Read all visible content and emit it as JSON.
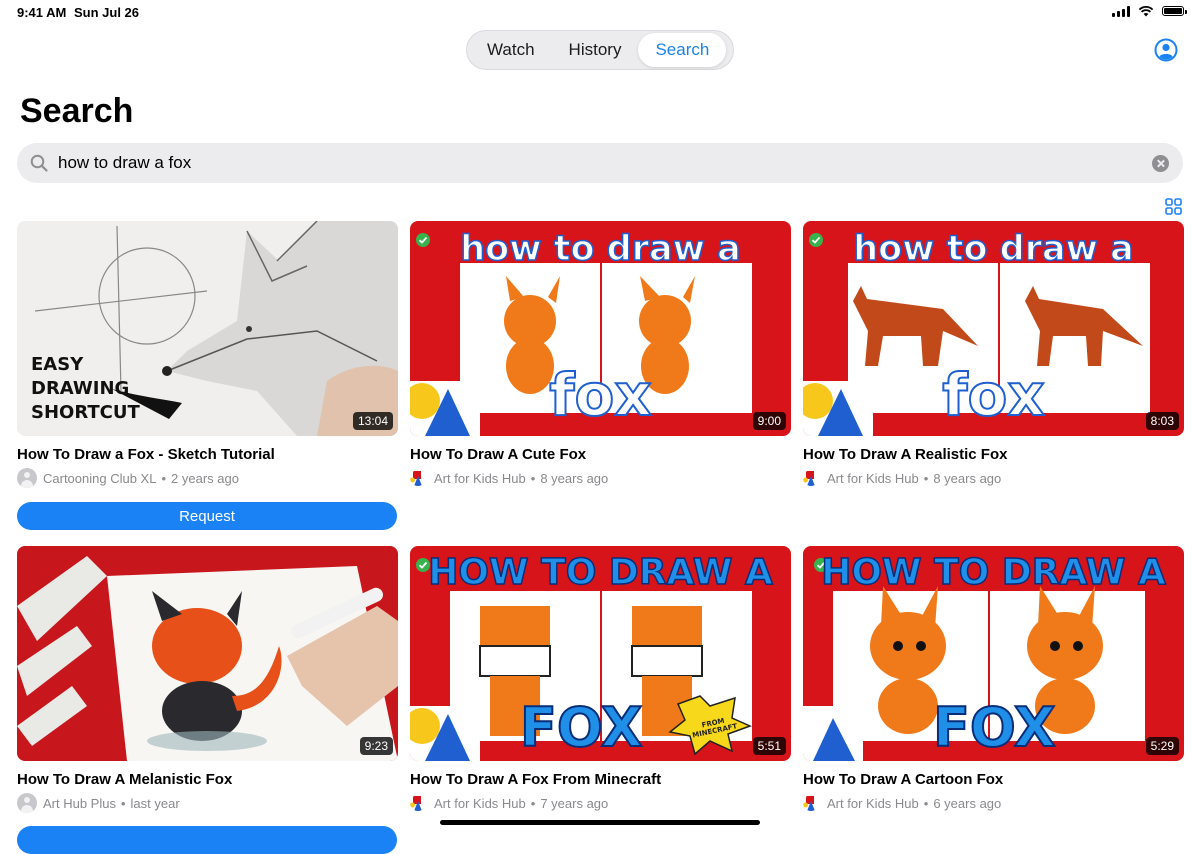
{
  "status_bar": {
    "time": "9:41 AM",
    "date": "Sun Jul 26"
  },
  "tabs": [
    {
      "label": "Watch",
      "active": false
    },
    {
      "label": "History",
      "active": false
    },
    {
      "label": "Search",
      "active": true
    }
  ],
  "page_title": "Search",
  "search": {
    "value": "how to draw a fox",
    "placeholder": "Search"
  },
  "videos": [
    {
      "title": "How To Draw a Fox - Sketch Tutorial",
      "channel": "Cartooning Club XL",
      "age": "2 years ago",
      "duration": "13:04",
      "thumb_text": [
        "EASY",
        "DRAWING",
        "SHORTCUT"
      ],
      "avatar": "person-icon"
    },
    {
      "title": "How To Draw A Cute Fox",
      "channel": "Art for Kids Hub",
      "age": "8 years ago",
      "duration": "9:00",
      "thumb_text": [
        "how to draw a",
        "fox"
      ],
      "avatar": "art-hub-logo"
    },
    {
      "title": "How To Draw A Realistic Fox",
      "channel": "Art for Kids Hub",
      "age": "8 years ago",
      "duration": "8:03",
      "thumb_text": [
        "how to draw a",
        "fox"
      ],
      "avatar": "art-hub-logo"
    },
    {
      "title": "How To Draw A Melanistic Fox",
      "channel": "Art Hub Plus",
      "age": "last year",
      "duration": "9:23",
      "thumb_text": [],
      "avatar": "person-icon"
    },
    {
      "title": "How To Draw A Fox From Minecraft",
      "channel": "Art for Kids Hub",
      "age": "7 years ago",
      "duration": "5:51",
      "thumb_text": [
        "HOW TO DRAW A",
        "FOX",
        "FROM MINECRAFT"
      ],
      "avatar": "art-hub-logo"
    },
    {
      "title": "How To Draw A Cartoon Fox",
      "channel": "Art for Kids Hub",
      "age": "6 years ago",
      "duration": "5:29",
      "thumb_text": [
        "HOW TO DRAW A",
        "FOX"
      ],
      "avatar": "art-hub-logo"
    }
  ],
  "request_label": "Request",
  "separator": "•",
  "colors": {
    "accent": "#1a82f5",
    "afkh_red": "#d7141a"
  }
}
